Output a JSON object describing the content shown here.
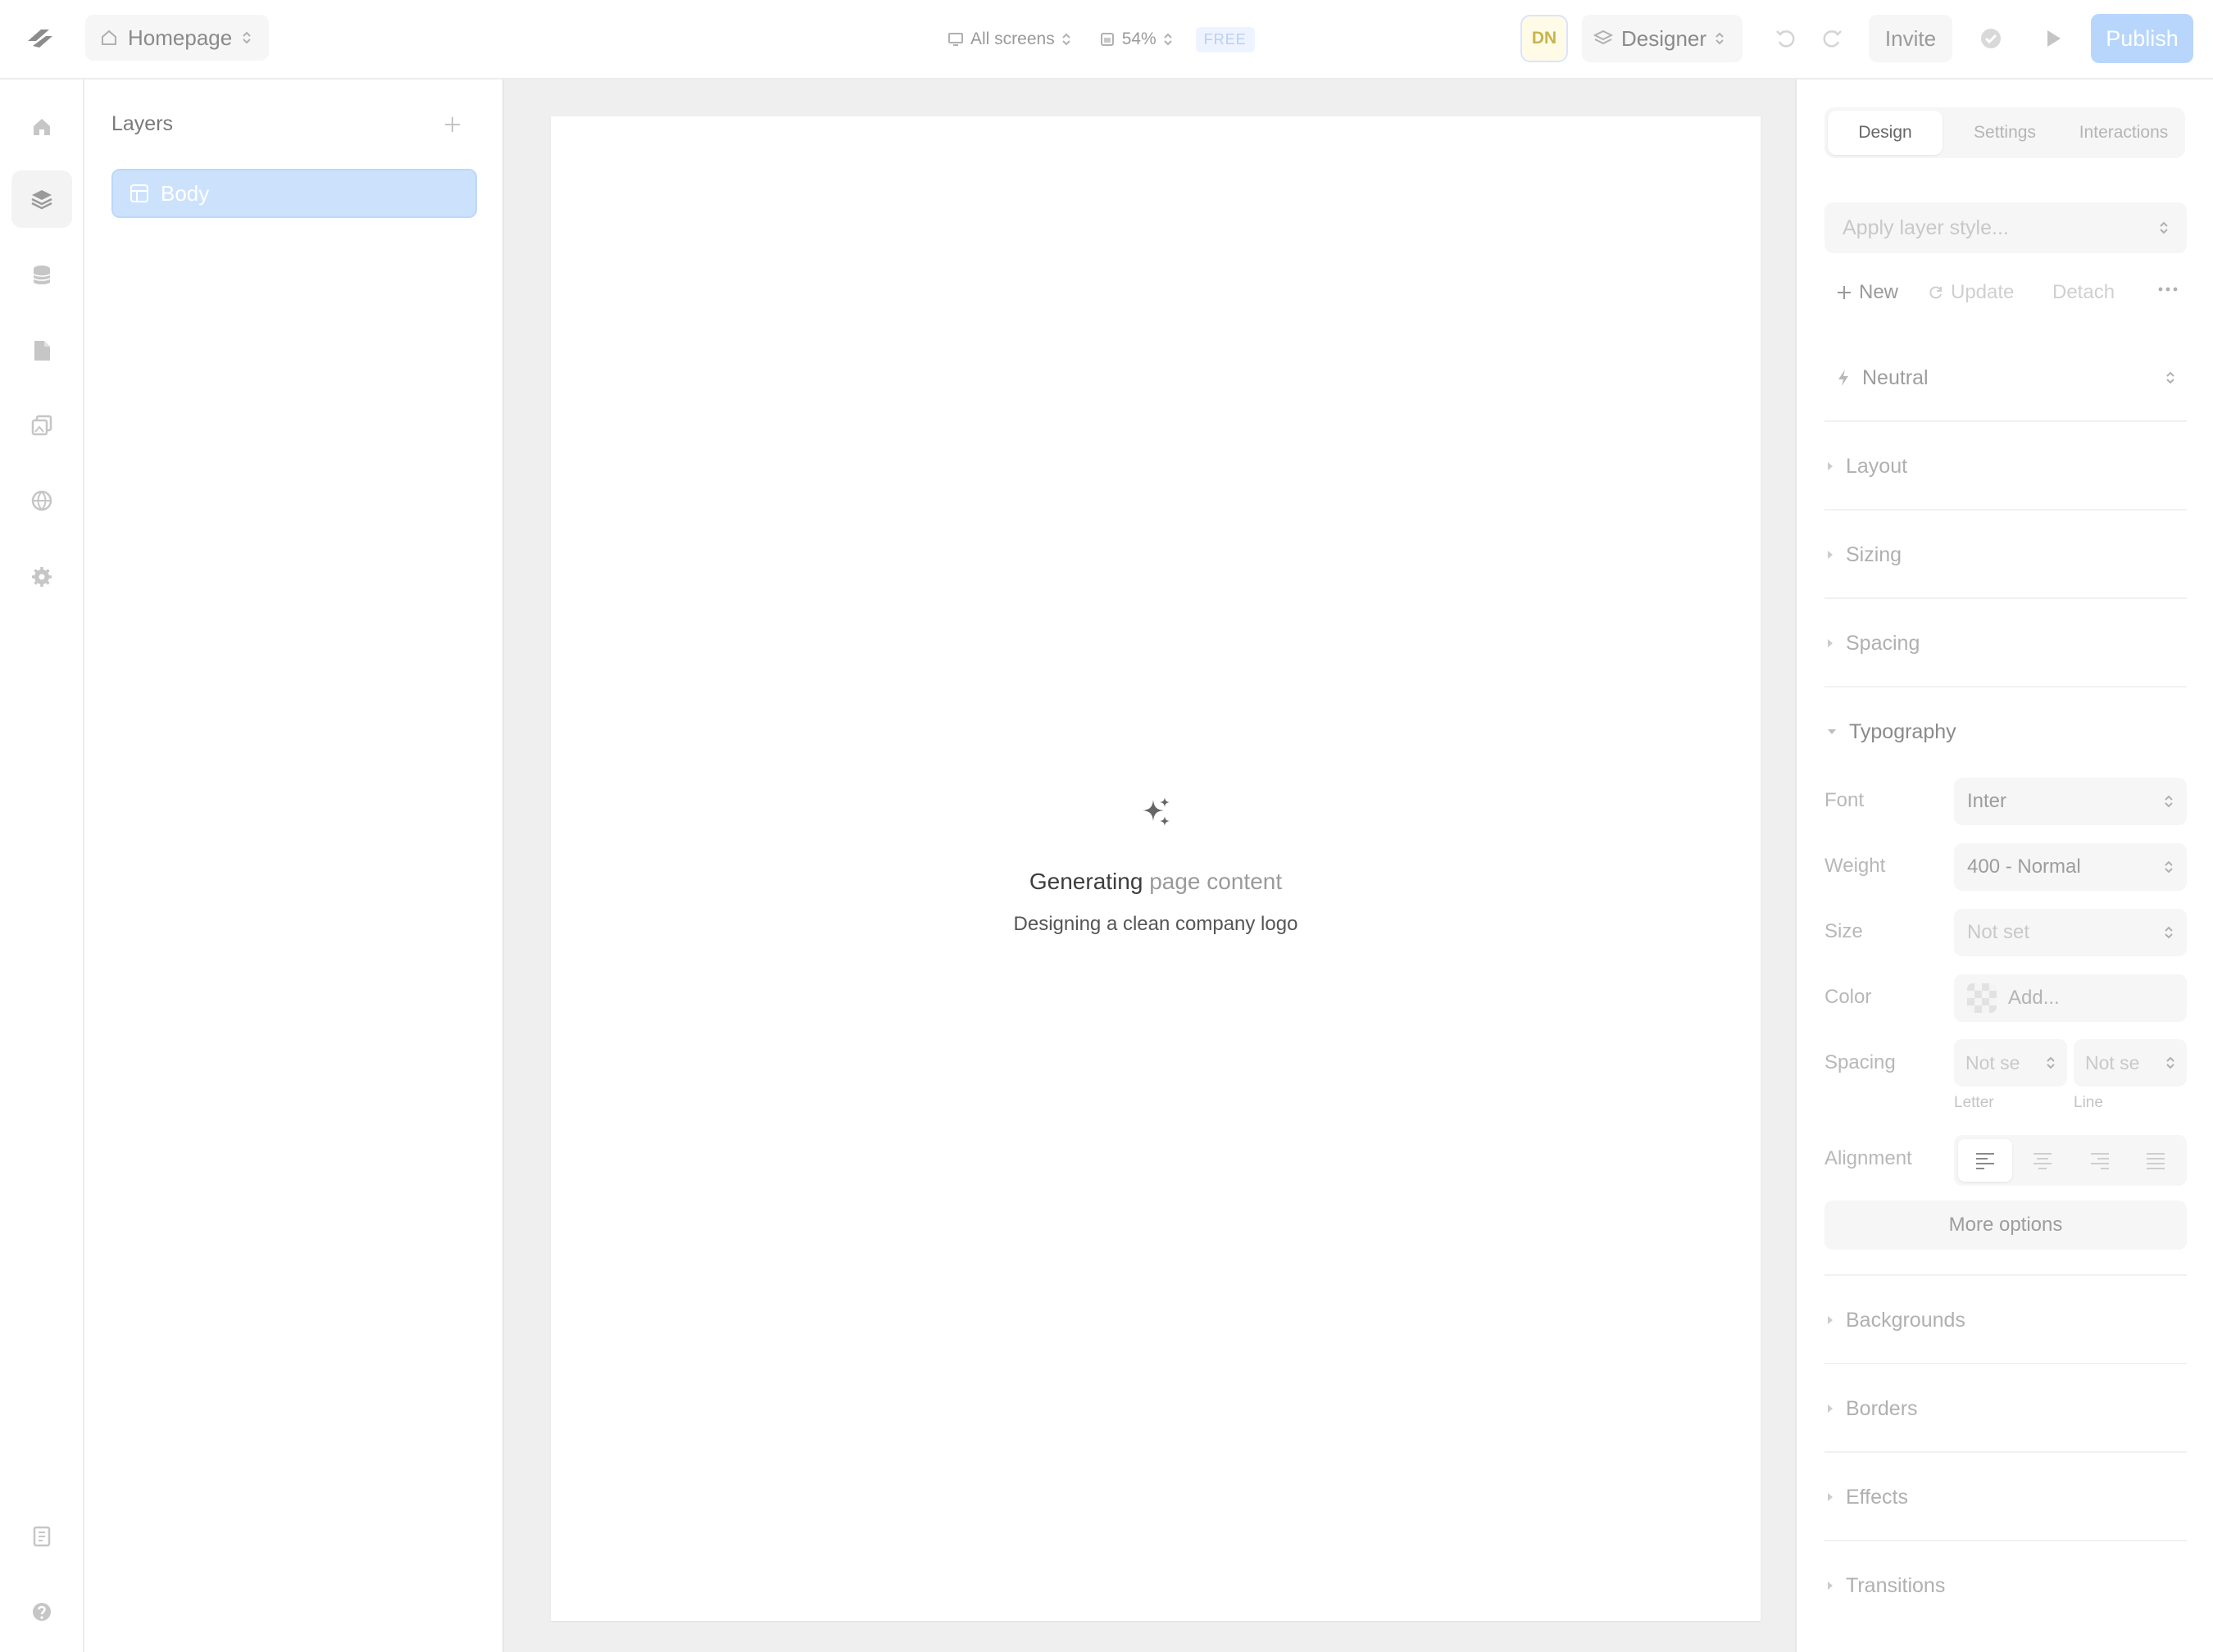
{
  "topbar": {
    "page_name": "Homepage",
    "screens_label": "All screens",
    "zoom_label": "54%",
    "plan_badge": "FREE",
    "avatar_initials": "DN",
    "role_label": "Designer",
    "invite_label": "Invite",
    "publish_label": "Publish"
  },
  "layers": {
    "title": "Layers",
    "items": [
      {
        "label": "Body",
        "icon": "layout-icon"
      }
    ]
  },
  "canvas": {
    "status_title_strong": "Generating",
    "status_title_faded": "page content",
    "status_subtitle": "Designing a clean company logo"
  },
  "right_panel": {
    "tabs": [
      "Design",
      "Settings",
      "Interactions"
    ],
    "active_tab": "Design",
    "layer_style_placeholder": "Apply layer style...",
    "style_actions": {
      "new_label": "New",
      "update_label": "Update",
      "detach_label": "Detach"
    },
    "variant_label": "Neutral",
    "sections": {
      "layout": "Layout",
      "sizing": "Sizing",
      "spacing": "Spacing",
      "typography": "Typography",
      "backgrounds": "Backgrounds",
      "borders": "Borders",
      "effects": "Effects",
      "transitions": "Transitions"
    },
    "typography": {
      "font_label": "Font",
      "font_value": "Inter",
      "weight_label": "Weight",
      "weight_value": "400 - Normal",
      "size_label": "Size",
      "size_value": "Not set",
      "color_label": "Color",
      "color_value": "Add...",
      "spacing_label": "Spacing",
      "letter_value": "Not se",
      "line_value": "Not se",
      "letter_caption": "Letter",
      "line_caption": "Line",
      "alignment_label": "Alignment",
      "more_options_label": "More options"
    }
  },
  "colors": {
    "accent": "#b8d6fb",
    "selection": "#cce2fc",
    "canvas_bg": "#efefef"
  }
}
